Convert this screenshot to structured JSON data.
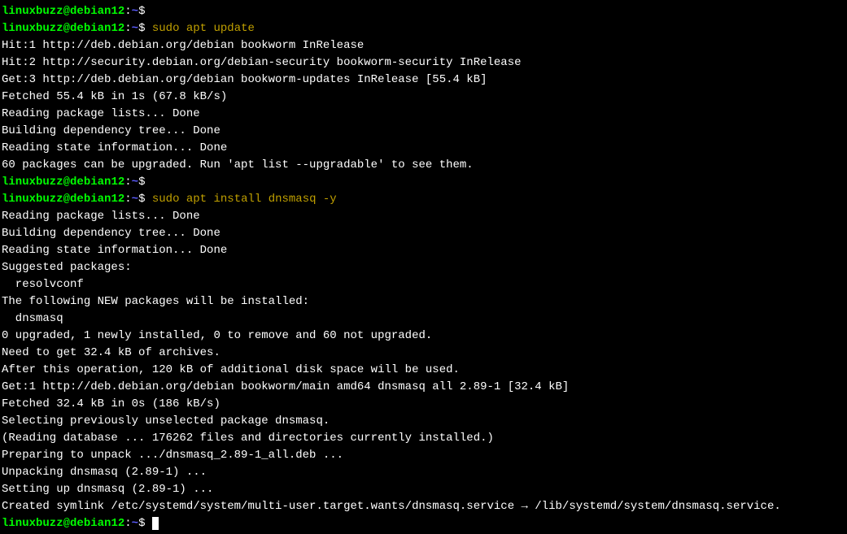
{
  "prompt": {
    "user": "linuxbuzz",
    "at": "@",
    "host": "debian12",
    "colon": ":",
    "path": "~",
    "dollar": "$"
  },
  "commands": {
    "cmd1": "sudo apt update",
    "cmd2": "sudo apt install dnsmasq -y"
  },
  "output": {
    "l1": "Hit:1 http://deb.debian.org/debian bookworm InRelease",
    "l2": "Hit:2 http://security.debian.org/debian-security bookworm-security InRelease",
    "l3": "Get:3 http://deb.debian.org/debian bookworm-updates InRelease [55.4 kB]",
    "l4": "Fetched 55.4 kB in 1s (67.8 kB/s)",
    "l5": "Reading package lists... Done",
    "l6": "Building dependency tree... Done",
    "l7": "Reading state information... Done",
    "l8": "60 packages can be upgraded. Run 'apt list --upgradable' to see them.",
    "l9": "Reading package lists... Done",
    "l10": "Building dependency tree... Done",
    "l11": "Reading state information... Done",
    "l12": "Suggested packages:",
    "l13": "  resolvconf",
    "l14": "The following NEW packages will be installed:",
    "l15": "  dnsmasq",
    "l16": "0 upgraded, 1 newly installed, 0 to remove and 60 not upgraded.",
    "l17": "Need to get 32.4 kB of archives.",
    "l18": "After this operation, 120 kB of additional disk space will be used.",
    "l19": "Get:1 http://deb.debian.org/debian bookworm/main amd64 dnsmasq all 2.89-1 [32.4 kB]",
    "l20": "Fetched 32.4 kB in 0s (186 kB/s)",
    "l21": "Selecting previously unselected package dnsmasq.",
    "l22": "(Reading database ... 176262 files and directories currently installed.)",
    "l23": "Preparing to unpack .../dnsmasq_2.89-1_all.deb ...",
    "l24": "Unpacking dnsmasq (2.89-1) ...",
    "l25": "Setting up dnsmasq (2.89-1) ...",
    "l26": "Created symlink /etc/systemd/system/multi-user.target.wants/dnsmasq.service → /lib/systemd/system/dnsmasq.service."
  }
}
